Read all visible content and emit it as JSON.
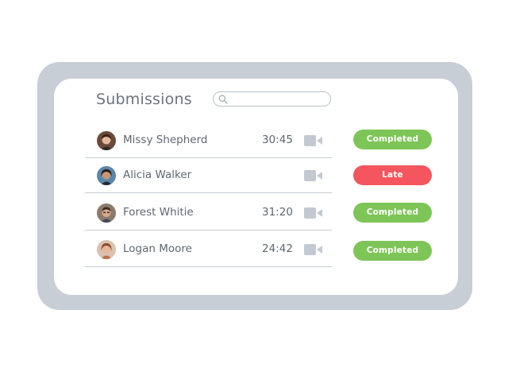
{
  "panel": {
    "title": "Submissions",
    "search": {
      "placeholder": "",
      "value": ""
    }
  },
  "colors": {
    "frame": "#c8ced6",
    "completed": "#7dc557",
    "late": "#f4555f",
    "text": "#5f6670"
  },
  "submissions": [
    {
      "name": "Missy Shepherd",
      "time": "30:45",
      "icon": "video-camera-icon",
      "status": "Completed"
    },
    {
      "name": "Alicia Walker",
      "time": "",
      "icon": "video-camera-icon",
      "status": "Late"
    },
    {
      "name": "Forest Whitie",
      "time": "31:20",
      "icon": "video-camera-icon",
      "status": "Completed"
    },
    {
      "name": "Logan Moore",
      "time": "24:42",
      "icon": "video-camera-icon",
      "status": "Completed"
    }
  ]
}
